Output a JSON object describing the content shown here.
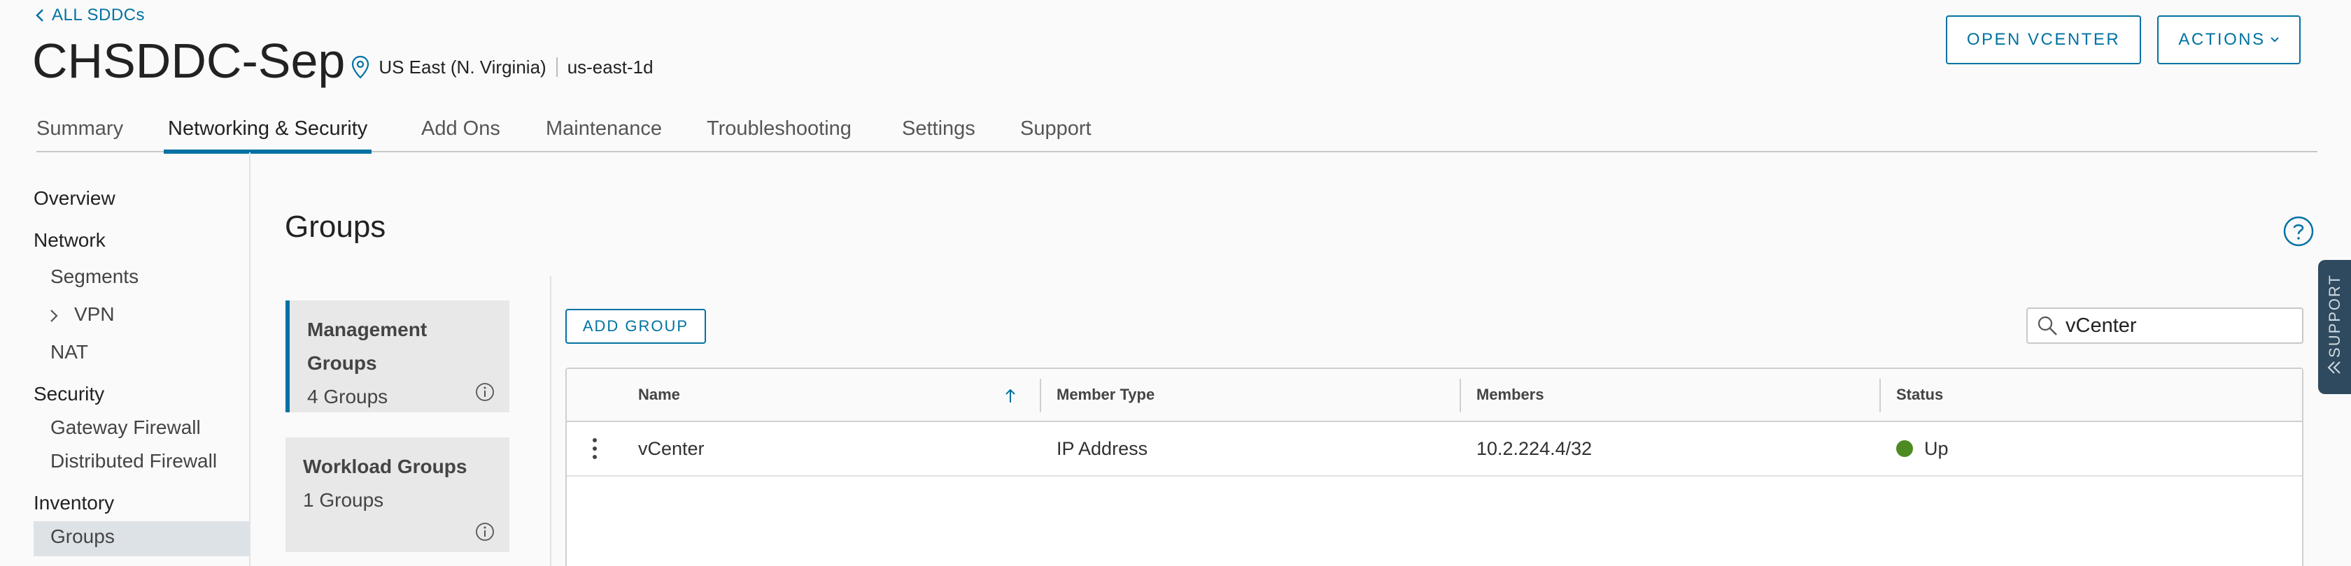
{
  "header": {
    "back_label": "ALL SDDCs",
    "sddc_name": "CHSDDC-Sep",
    "region": "US East (N. Virginia)",
    "zone": "us-east-1d",
    "open_vcenter_label": "OPEN VCENTER",
    "actions_label": "ACTIONS"
  },
  "tabs": [
    {
      "label": "Summary"
    },
    {
      "label": "Networking & Security",
      "active": true
    },
    {
      "label": "Add Ons"
    },
    {
      "label": "Maintenance"
    },
    {
      "label": "Troubleshooting"
    },
    {
      "label": "Settings"
    },
    {
      "label": "Support"
    }
  ],
  "sidebar": {
    "overview": "Overview",
    "network": "Network",
    "segments": "Segments",
    "vpn": "VPN",
    "nat": "NAT",
    "security": "Security",
    "gateway_firewall": "Gateway Firewall",
    "distributed_firewall": "Distributed Firewall",
    "inventory": "Inventory",
    "groups": "Groups"
  },
  "main": {
    "title": "Groups",
    "add_group_label": "ADD GROUP",
    "search_value": "vCenter"
  },
  "cards": [
    {
      "title_line1": "Management",
      "title_line2": "Groups",
      "count": "4 Groups",
      "active": true
    },
    {
      "title_line1": "Workload Groups",
      "count": "1 Groups",
      "active": false
    }
  ],
  "grid": {
    "columns": [
      "Name",
      "Member Type",
      "Members",
      "Status"
    ],
    "rows": [
      {
        "name": "vCenter",
        "member_type": "IP Address",
        "members": "10.2.224.4/32",
        "status": "Up"
      }
    ]
  },
  "support_tab_label": "SUPPORT",
  "colors": {
    "accent": "#0072a3",
    "status_up": "#4d8b22",
    "support_tab": "#2f4a5e"
  }
}
